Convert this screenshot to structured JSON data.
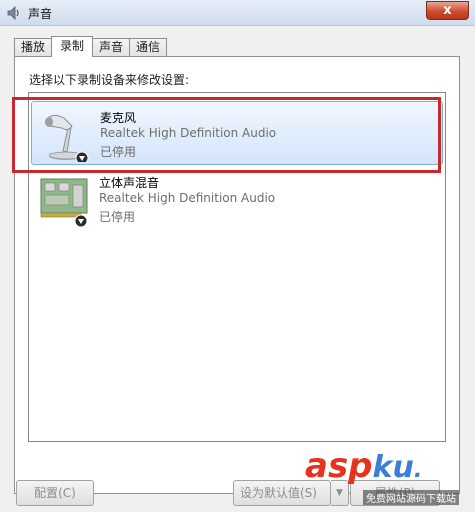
{
  "window": {
    "title": "声音",
    "close_label": "x"
  },
  "tabs": [
    {
      "label": "播放"
    },
    {
      "label": "录制",
      "active": true
    },
    {
      "label": "声音"
    },
    {
      "label": "通信"
    }
  ],
  "panel": {
    "instruction": "选择以下录制设备来修改设置:",
    "devices": [
      {
        "name": "麦克风",
        "driver": "Realtek High Definition Audio",
        "status": "已停用",
        "icon": "microphone-icon",
        "selected": true
      },
      {
        "name": "立体声混音",
        "driver": "Realtek High Definition Audio",
        "status": "已停用",
        "icon": "sound-card-icon",
        "selected": false
      }
    ]
  },
  "buttons": {
    "configure": "配置(C)",
    "set_default": "设为默认值(S)",
    "properties": "属性(P)"
  },
  "watermark": {
    "logo_main": "asp",
    "logo_accent": "ku",
    "logo_dot": ".",
    "sub": "免费网站源码下载站"
  },
  "colors": {
    "highlight_border": "#c8282c",
    "selection_fill": "#d3e5fa",
    "close_button": "#cf4b2f"
  }
}
